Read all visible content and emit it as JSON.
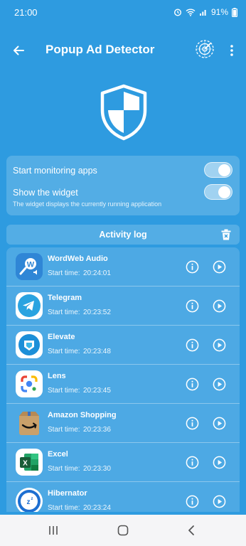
{
  "status_bar": {
    "time": "21:00",
    "battery": "91%"
  },
  "app_bar": {
    "title": "Popup Ad Detector",
    "icons": [
      "back-arrow-icon",
      "radar-icon",
      "more-vert-icon"
    ]
  },
  "settings": {
    "monitoring_label": "Start monitoring apps",
    "monitoring_on": true,
    "widget_label": "Show the widget",
    "widget_on": true,
    "widget_hint": "The widget displays the currently running application"
  },
  "activity_log": {
    "title": "Activity log",
    "start_label": "Start time:",
    "items": [
      {
        "name": "WordWeb Audio",
        "time": "20:24:01",
        "icon": "wordweb-icon"
      },
      {
        "name": "Telegram",
        "time": "20:23:52",
        "icon": "telegram-icon"
      },
      {
        "name": "Elevate",
        "time": "20:23:48",
        "icon": "elevate-icon"
      },
      {
        "name": "Lens",
        "time": "20:23:45",
        "icon": "lens-icon"
      },
      {
        "name": "Amazon Shopping",
        "time": "20:23:36",
        "icon": "amazon-icon"
      },
      {
        "name": "Excel",
        "time": "20:23:30",
        "icon": "excel-icon"
      },
      {
        "name": "Hibernator",
        "time": "20:23:24",
        "icon": "hibernator-icon"
      }
    ]
  },
  "colors": {
    "background": "#2e9be0",
    "card": "rgba(255,255,255,0.18)",
    "nav_bar": "#f5f5f7"
  }
}
